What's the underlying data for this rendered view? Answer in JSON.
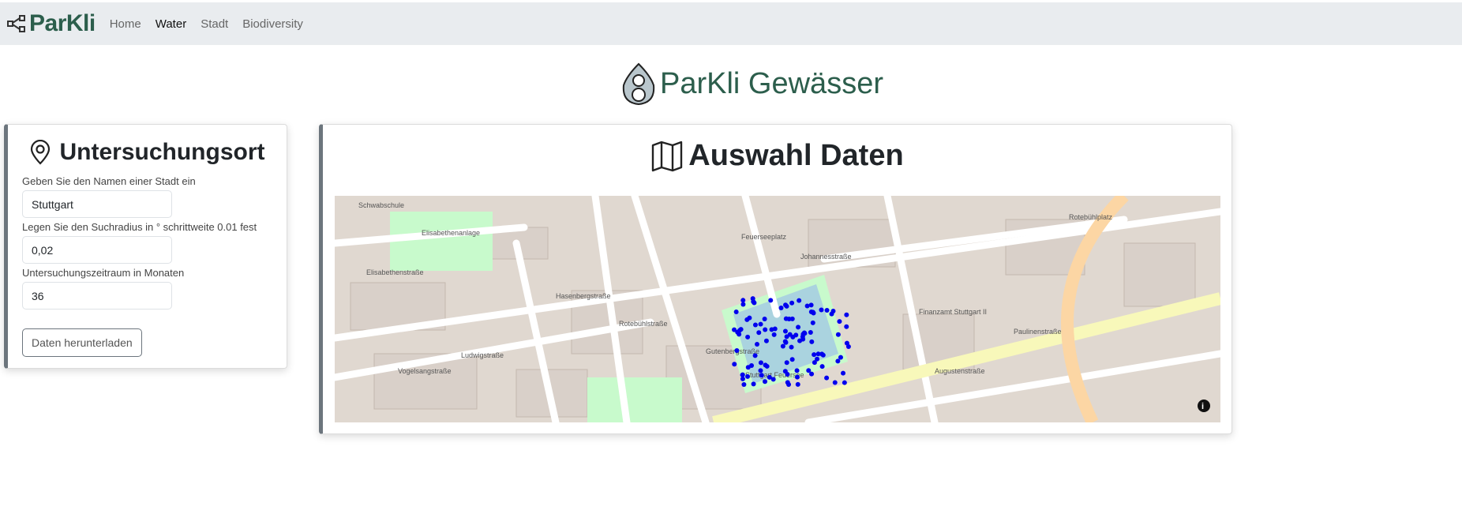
{
  "navbar": {
    "brand": "ParKli",
    "links": [
      {
        "label": "Home",
        "active": false
      },
      {
        "label": "Water",
        "active": true
      },
      {
        "label": "Stadt",
        "active": false
      },
      {
        "label": "Biodiversity",
        "active": false
      }
    ]
  },
  "page_title": "ParKli Gewässer",
  "location_card": {
    "title": "Untersuchungsort",
    "icon": "map-pin-icon",
    "city_label": "Geben Sie den Namen einer Stadt ein",
    "city_value": "Stuttgart",
    "radius_label": "Legen Sie den Suchradius in ° schrittweite 0.01 fest",
    "radius_value": "0,02",
    "period_label": "Untersuchungszeitraum in Monaten",
    "period_value": "36",
    "download_button": "Daten herunterladen"
  },
  "data_card": {
    "title": "Auswahl Daten",
    "icon": "map-icon"
  },
  "map": {
    "marker_color": "#0000ee",
    "lake_color": "#aad3df",
    "park_color": "#c8facc",
    "labels": [
      "Elisabethenstraße",
      "Ludwigstraße",
      "Vogelsangstraße",
      "Gutenbergstraße",
      "Rotebühlstraße",
      "Feuerseeplatz",
      "Johannesstraße",
      "Paulinenstraße",
      "Rotebühlplatz",
      "Augustenstraße",
      "Elisabethenanlage",
      "Finanzamt Stuttgart II",
      "Stuttgart Feuersee",
      "Hasenbergstraße",
      "Schwabschule"
    ]
  }
}
